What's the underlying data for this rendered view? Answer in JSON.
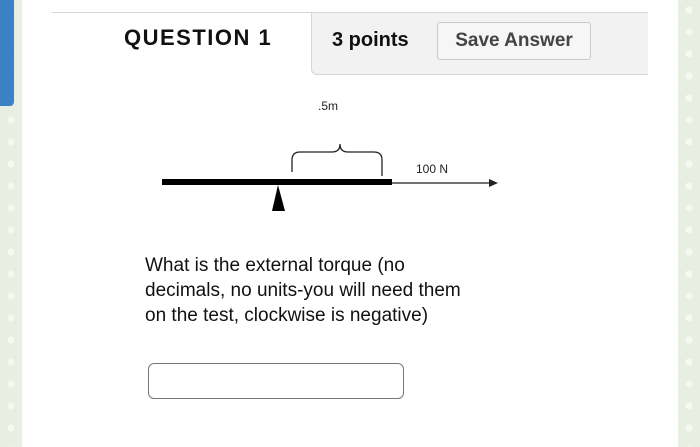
{
  "question": {
    "title": "QUESTION 1",
    "points": "3 points",
    "save_label": "Save Answer",
    "text": "What is the external torque (no decimals, no units-you will need them on the test, clockwise is negative)"
  },
  "diagram": {
    "distance_label": ".5m",
    "force_label": "100 N"
  },
  "answer": {
    "value": ""
  }
}
